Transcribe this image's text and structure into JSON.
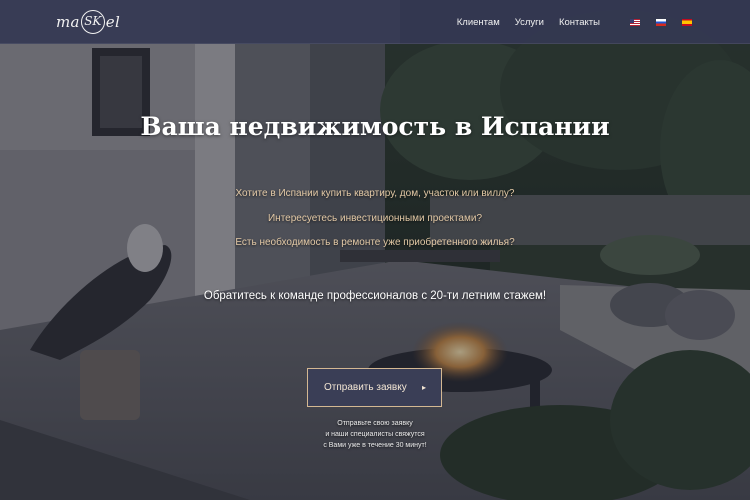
{
  "header": {
    "logo": {
      "left": "ma",
      "ring": "SK",
      "right": "el"
    },
    "nav": [
      {
        "label": "Клиентам"
      },
      {
        "label": "Услуги"
      },
      {
        "label": "Контакты"
      }
    ],
    "languages": [
      "english-flag-icon",
      "russian-flag-icon",
      "spanish-flag-icon"
    ]
  },
  "hero": {
    "title": "Ваша недвижимость в Испании",
    "questions": [
      "Хотите в Испании купить квартиру, дом, участок или виллу?",
      "Интересуетесь инвестиционными проектами?",
      "Есть необходимость в ремонте уже приобретенного жилья?"
    ],
    "cta_text": "Обратитесь к команде профессионалов с 20-ти летним стажем!",
    "button_label": "Отправить заявку",
    "button_icon": "arrow-right-icon",
    "note_lines": [
      "Отправьте свою заявку",
      "и наши специалисты свяжутся",
      "с Вами уже в течение 30 минут!"
    ]
  },
  "colors": {
    "header_bg": "#343852",
    "accent_gold": "#d4b892",
    "question_text": "#e3c9a6",
    "button_bg": "#3a3e56"
  }
}
